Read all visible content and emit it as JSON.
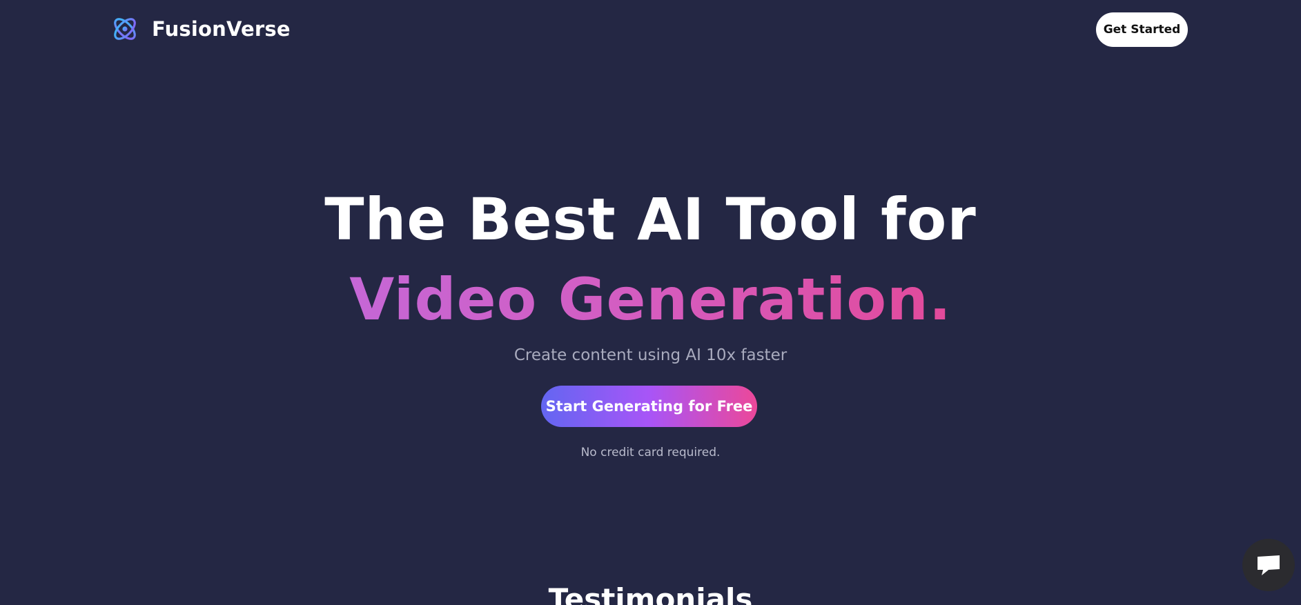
{
  "header": {
    "brand": "FusionVerse",
    "logo_icon": "atom-orbit-logo-icon",
    "cta_label": "Get Started"
  },
  "hero": {
    "title_line_1": "The Best AI Tool for",
    "title_line_2": "Video Generation.",
    "subtitle": "Create content using AI 10x faster",
    "cta_label": "Start Generating for Free",
    "note": "No credit card required."
  },
  "testimonials": {
    "heading": "Testimonials"
  },
  "chat_widget": {
    "icon": "chat-bubble-icon"
  },
  "colors": {
    "background": "#242744",
    "gradient_start": "#6366f1",
    "gradient_mid": "#a855f7",
    "gradient_end": "#ec4899",
    "title_gradient_start": "#c567d6",
    "title_gradient_end": "#e24a9a"
  }
}
